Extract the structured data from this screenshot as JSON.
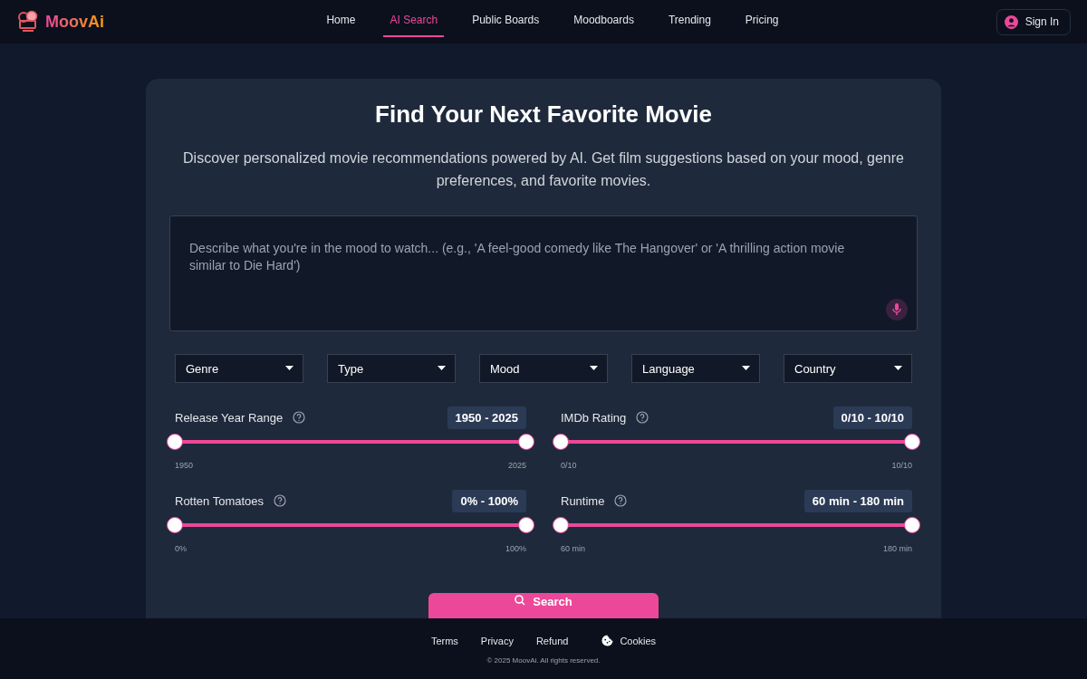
{
  "header": {
    "logo": "MoovAi",
    "nav": [
      {
        "label": "Home",
        "selected": false
      },
      {
        "label": "AI Search",
        "selected": true
      },
      {
        "label": "Public Boards",
        "selected": false
      },
      {
        "label": "Moodboards",
        "selected": false
      },
      {
        "label": "Trending",
        "selected": false
      },
      {
        "label": "Pricing",
        "selected": false
      }
    ],
    "sign_in": "Sign In"
  },
  "hero": {
    "title": "Find Your Next Favorite Movie",
    "subtitle": "Discover personalized movie recommendations powered by AI. Get film suggestions based on your mood, genre preferences, and favorite movies."
  },
  "prompt": {
    "placeholder": "Describe what you're in the mood to watch... (e.g., 'A feel-good comedy like The Hangover' or 'A thrilling action movie similar to Die Hard')"
  },
  "filters": [
    "Genre",
    "Type",
    "Mood",
    "Language",
    "Country"
  ],
  "ranges": [
    {
      "label": "Release Year Range",
      "value": "1950 - 2025",
      "min": "1950",
      "max": "2025",
      "thumbs": [
        {
          "level": 0
        },
        {
          "level": 1
        }
      ]
    },
    {
      "label": "IMDb Rating",
      "value": "0/10 - 10/10",
      "min": "0/10",
      "max": "10/10",
      "thumbs": [
        {
          "level": 0
        },
        {
          "level": 1
        }
      ]
    },
    {
      "label": "Rotten Tomatoes",
      "value": "0% - 100%",
      "min": "0%",
      "max": "100%",
      "thumbs": [
        {
          "level": 0
        },
        {
          "level": 1
        }
      ]
    },
    {
      "label": "Runtime",
      "value": "60 min - 180 min",
      "min": "60 min",
      "max": "180 min",
      "thumbs": [
        {
          "level": 0
        },
        {
          "level": 1
        }
      ]
    }
  ],
  "search_button": "Search",
  "footer": {
    "links": [
      "Terms",
      "Privacy",
      "Refund"
    ],
    "cookies": "Cookies",
    "copyright": "© 2025 MoovAi. All rights reserved."
  }
}
